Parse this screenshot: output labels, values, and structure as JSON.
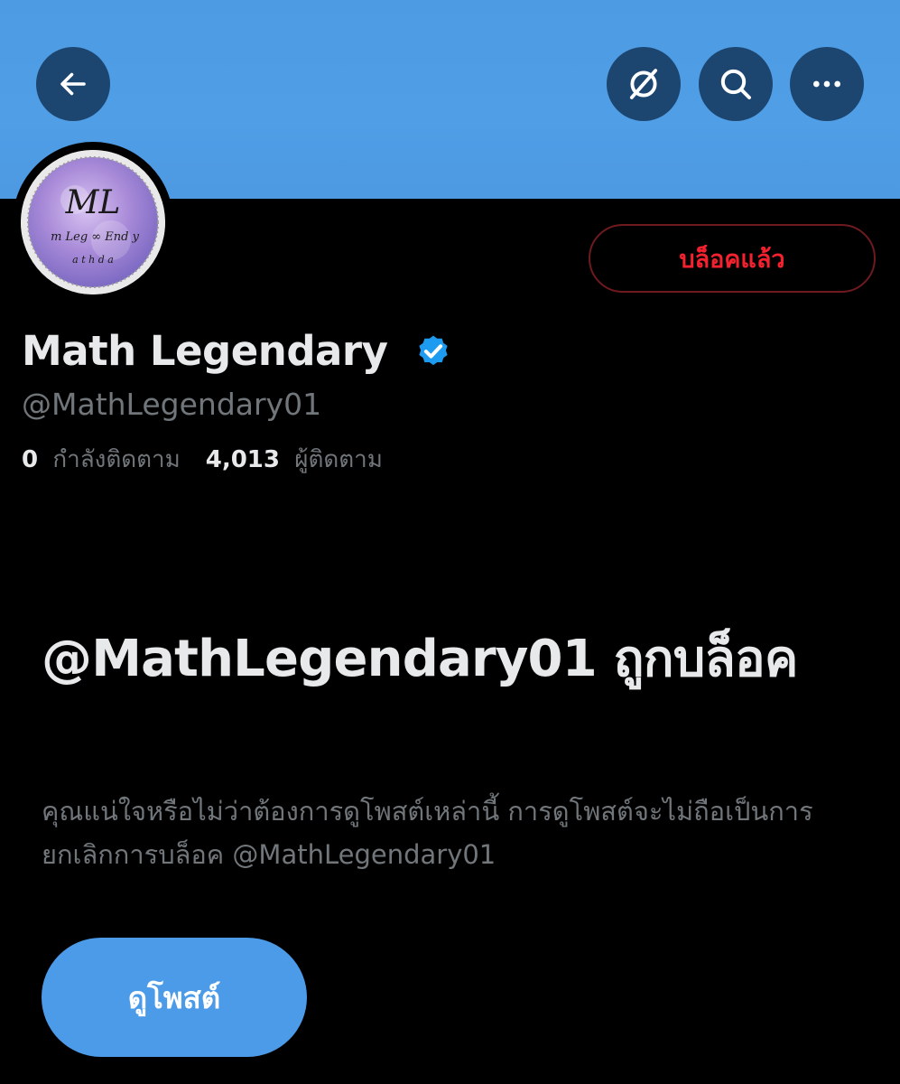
{
  "header": {
    "back_icon": "arrow-left-icon",
    "grok_icon": "grok-icon",
    "search_icon": "search-icon",
    "more_icon": "more-horizontal-icon",
    "banner_color": "#4d9be3",
    "button_color": "#1c4670"
  },
  "profile": {
    "avatar_text_main": "ML",
    "avatar_text_sub": "m Leg ∞ End y",
    "avatar_text_sub2": "a t h  d  a",
    "blocked_button_label": "บล็อคแล้ว",
    "display_name": "Math Legendary",
    "verified_icon": "verified-badge-icon",
    "handle": "@MathLegendary01",
    "following_count": "0",
    "following_label": "กำลังติดตาม",
    "followers_count": "4,013",
    "followers_label": "ผู้ติดตาม"
  },
  "blocked_notice": {
    "title": "@MathLegendary01 ถูกบล็อค",
    "description": "คุณแน่ใจหรือไม่ว่าต้องการดูโพสต์เหล่านี้ การดูโพสต์จะไม่ถือเป็นการยกเลิกการบล็อค @MathLegendary01",
    "view_posts_label": "ดูโพสต์"
  },
  "colors": {
    "accent": "#4c9be8",
    "blocked_red": "#f4212e",
    "text_primary": "#e7e9ea",
    "text_secondary": "#71767b",
    "background": "#000000"
  }
}
